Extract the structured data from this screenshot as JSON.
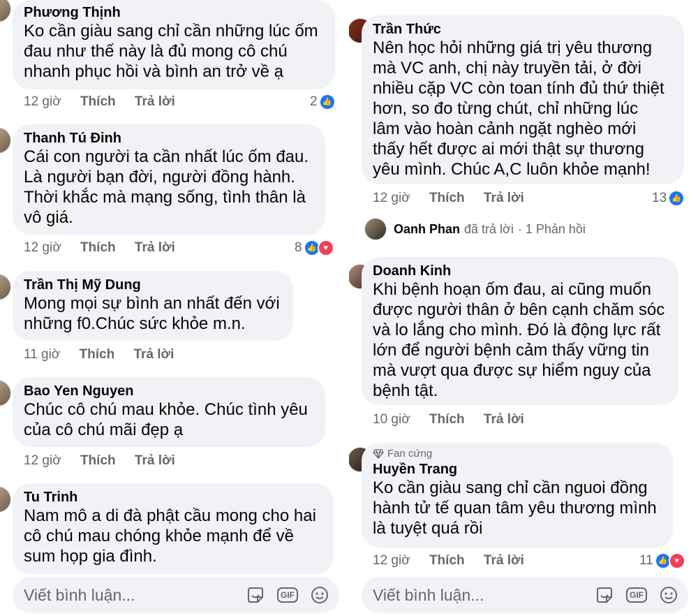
{
  "left": {
    "comments": [
      {
        "author": "Phương Thịnh",
        "lines": [
          "Ko cần giàu sang chỉ cần những lúc ốm",
          "đau như thế này là đủ mong cô chú",
          "nhanh phục hồi và bình an trở về ạ"
        ],
        "time": "12 giờ",
        "like": "Thích",
        "reply": "Trả lời",
        "reactions": "2"
      },
      {
        "author": "Thanh Tú Đinh",
        "lines": [
          "Cái con người ta cần nhất lúc ốm đau.",
          "Là người bạn đời, người đồng hành.",
          "Thời khắc mà mạng sống, tình thân là",
          "vô giá."
        ],
        "time": "12 giờ",
        "like": "Thích",
        "reply": "Trả lời",
        "reactions": "8"
      },
      {
        "author": "Trần Thị Mỹ Dung",
        "lines": [
          "Mong mọi sự bình an nhất đến với",
          "những f0.Chúc sức khỏe m.n."
        ],
        "time": "11 giờ",
        "like": "Thích",
        "reply": "Trả lời"
      },
      {
        "author": "Bao Yen Nguyen",
        "lines": [
          "Chúc cô chú mau khỏe. Chúc tình yêu",
          "của cô chú mãi đẹp ạ"
        ],
        "time": "12 giờ",
        "like": "Thích",
        "reply": "Trả lời"
      },
      {
        "author": "Tu Trinh",
        "lines": [
          "Nam mô a di đà phật cầu mong cho hai",
          "cô chú mau chóng khỏe mạnh để về",
          "sum họp gia đình."
        ]
      }
    ],
    "composer_placeholder": "Viết bình luận..."
  },
  "right": {
    "comments": [
      {
        "author": "Trần Thức",
        "lines": [
          "Nên học hỏi những giá trị yêu thương",
          "mà VC anh, chị này truyền tải, ở đời",
          "nhiều cặp VC còn toan tính đủ thứ thiệt",
          "hơn, so đo từng chút, chỉ những lúc",
          "lâm vào hoàn cảnh ngặt nghèo mới",
          "thấy hết được ai mới thật sự thương",
          "yêu mình. Chúc A,C luôn khỏe mạnh!"
        ],
        "time": "12 giờ",
        "like": "Thích",
        "reply": "Trả lời",
        "reactions": "13"
      },
      {
        "author": "Doanh Kinh",
        "lines": [
          "Khi bệnh hoạn ốm đau, ai cũng muốn",
          "được người thân ở bên cạnh chăm sóc",
          "và lo lắng cho mình. Đó là động lực rất",
          "lớn để người bệnh cảm thấy vững tin",
          "mà vượt qua được sự hiểm nguy của",
          "bệnh tật."
        ],
        "time": "10 giờ",
        "like": "Thích",
        "reply": "Trả lời"
      },
      {
        "badge": "Fan cứng",
        "author": "Huyền Trang",
        "lines": [
          "Ko cần giàu sang chỉ cần nguoi đồng",
          "hành tử tế quan tâm yêu thương mình",
          "là tuyệt quá rồi"
        ],
        "time": "12 giờ",
        "like": "Thích",
        "reply": "Trả lời",
        "reactions": "11"
      }
    ],
    "reply_summary": {
      "name": "Oanh Phan",
      "action": "đã trả lời",
      "count": "· 1 Phản hồi"
    },
    "composer_placeholder": "Viết bình luận..."
  },
  "icons": {
    "like": "like-icon",
    "heart": "heart-icon",
    "sticker": "sticker-icon",
    "gif": "GIF",
    "emoji": "emoji-icon",
    "diamond": "diamond-icon"
  },
  "colors": {
    "bubble": "#f0f2f5",
    "meta": "#65676b",
    "like_blue": "#1877f2",
    "love_red": "#f33e58"
  }
}
